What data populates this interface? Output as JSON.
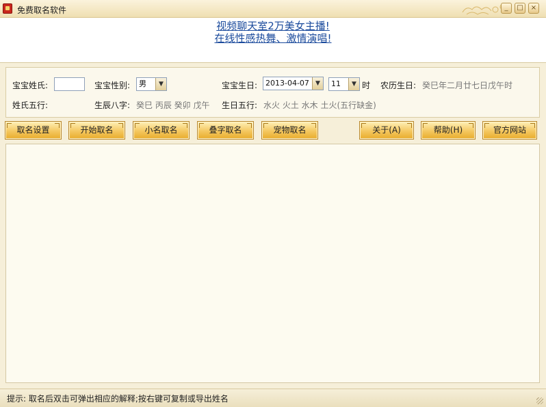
{
  "window": {
    "title": "免费取名软件",
    "controls": {
      "minimize": "_",
      "maximize": "□",
      "close": "×"
    }
  },
  "banner": {
    "ad_line1": "视频聊天室2万美女主播!",
    "ad_line2": "在线性感热舞、激情演唱!"
  },
  "form": {
    "surname_label": "宝宝姓氏:",
    "surname_value": "",
    "gender_label": "宝宝性别:",
    "gender_value": "男",
    "birthday_label": "宝宝生日:",
    "birthday_value": "2013-04-07",
    "hour_value": "11",
    "hour_unit": "时",
    "lunar_label": "农历生日:",
    "lunar_value": "癸巳年二月廿七日戊午时",
    "surname_wuxing_label": "姓氏五行:",
    "bazi_label": "生辰八字:",
    "bazi_value": "癸巳 丙辰 癸卯 戊午",
    "birth_wuxing_label": "生日五行:",
    "birth_wuxing_value": "水火 火土 水木 土火(五行缺金)"
  },
  "buttons": {
    "settings": "取名设置",
    "start": "开始取名",
    "nickname": "小名取名",
    "double": "叠字取名",
    "pet": "宠物取名",
    "about": "关于(A)",
    "help": "帮助(H)",
    "website": "官方网站"
  },
  "status": {
    "hint": "提示: 取名后双击可弹出相应的解释;按右键可复制或导出姓名"
  },
  "icons": {
    "app": "app-icon",
    "dropdown": "chevron-down-icon",
    "grip": "resize-grip-icon"
  },
  "colors": {
    "ad_link": "#1a4a9c",
    "button_gold": "#f4c760",
    "background": "#f6efd9"
  }
}
